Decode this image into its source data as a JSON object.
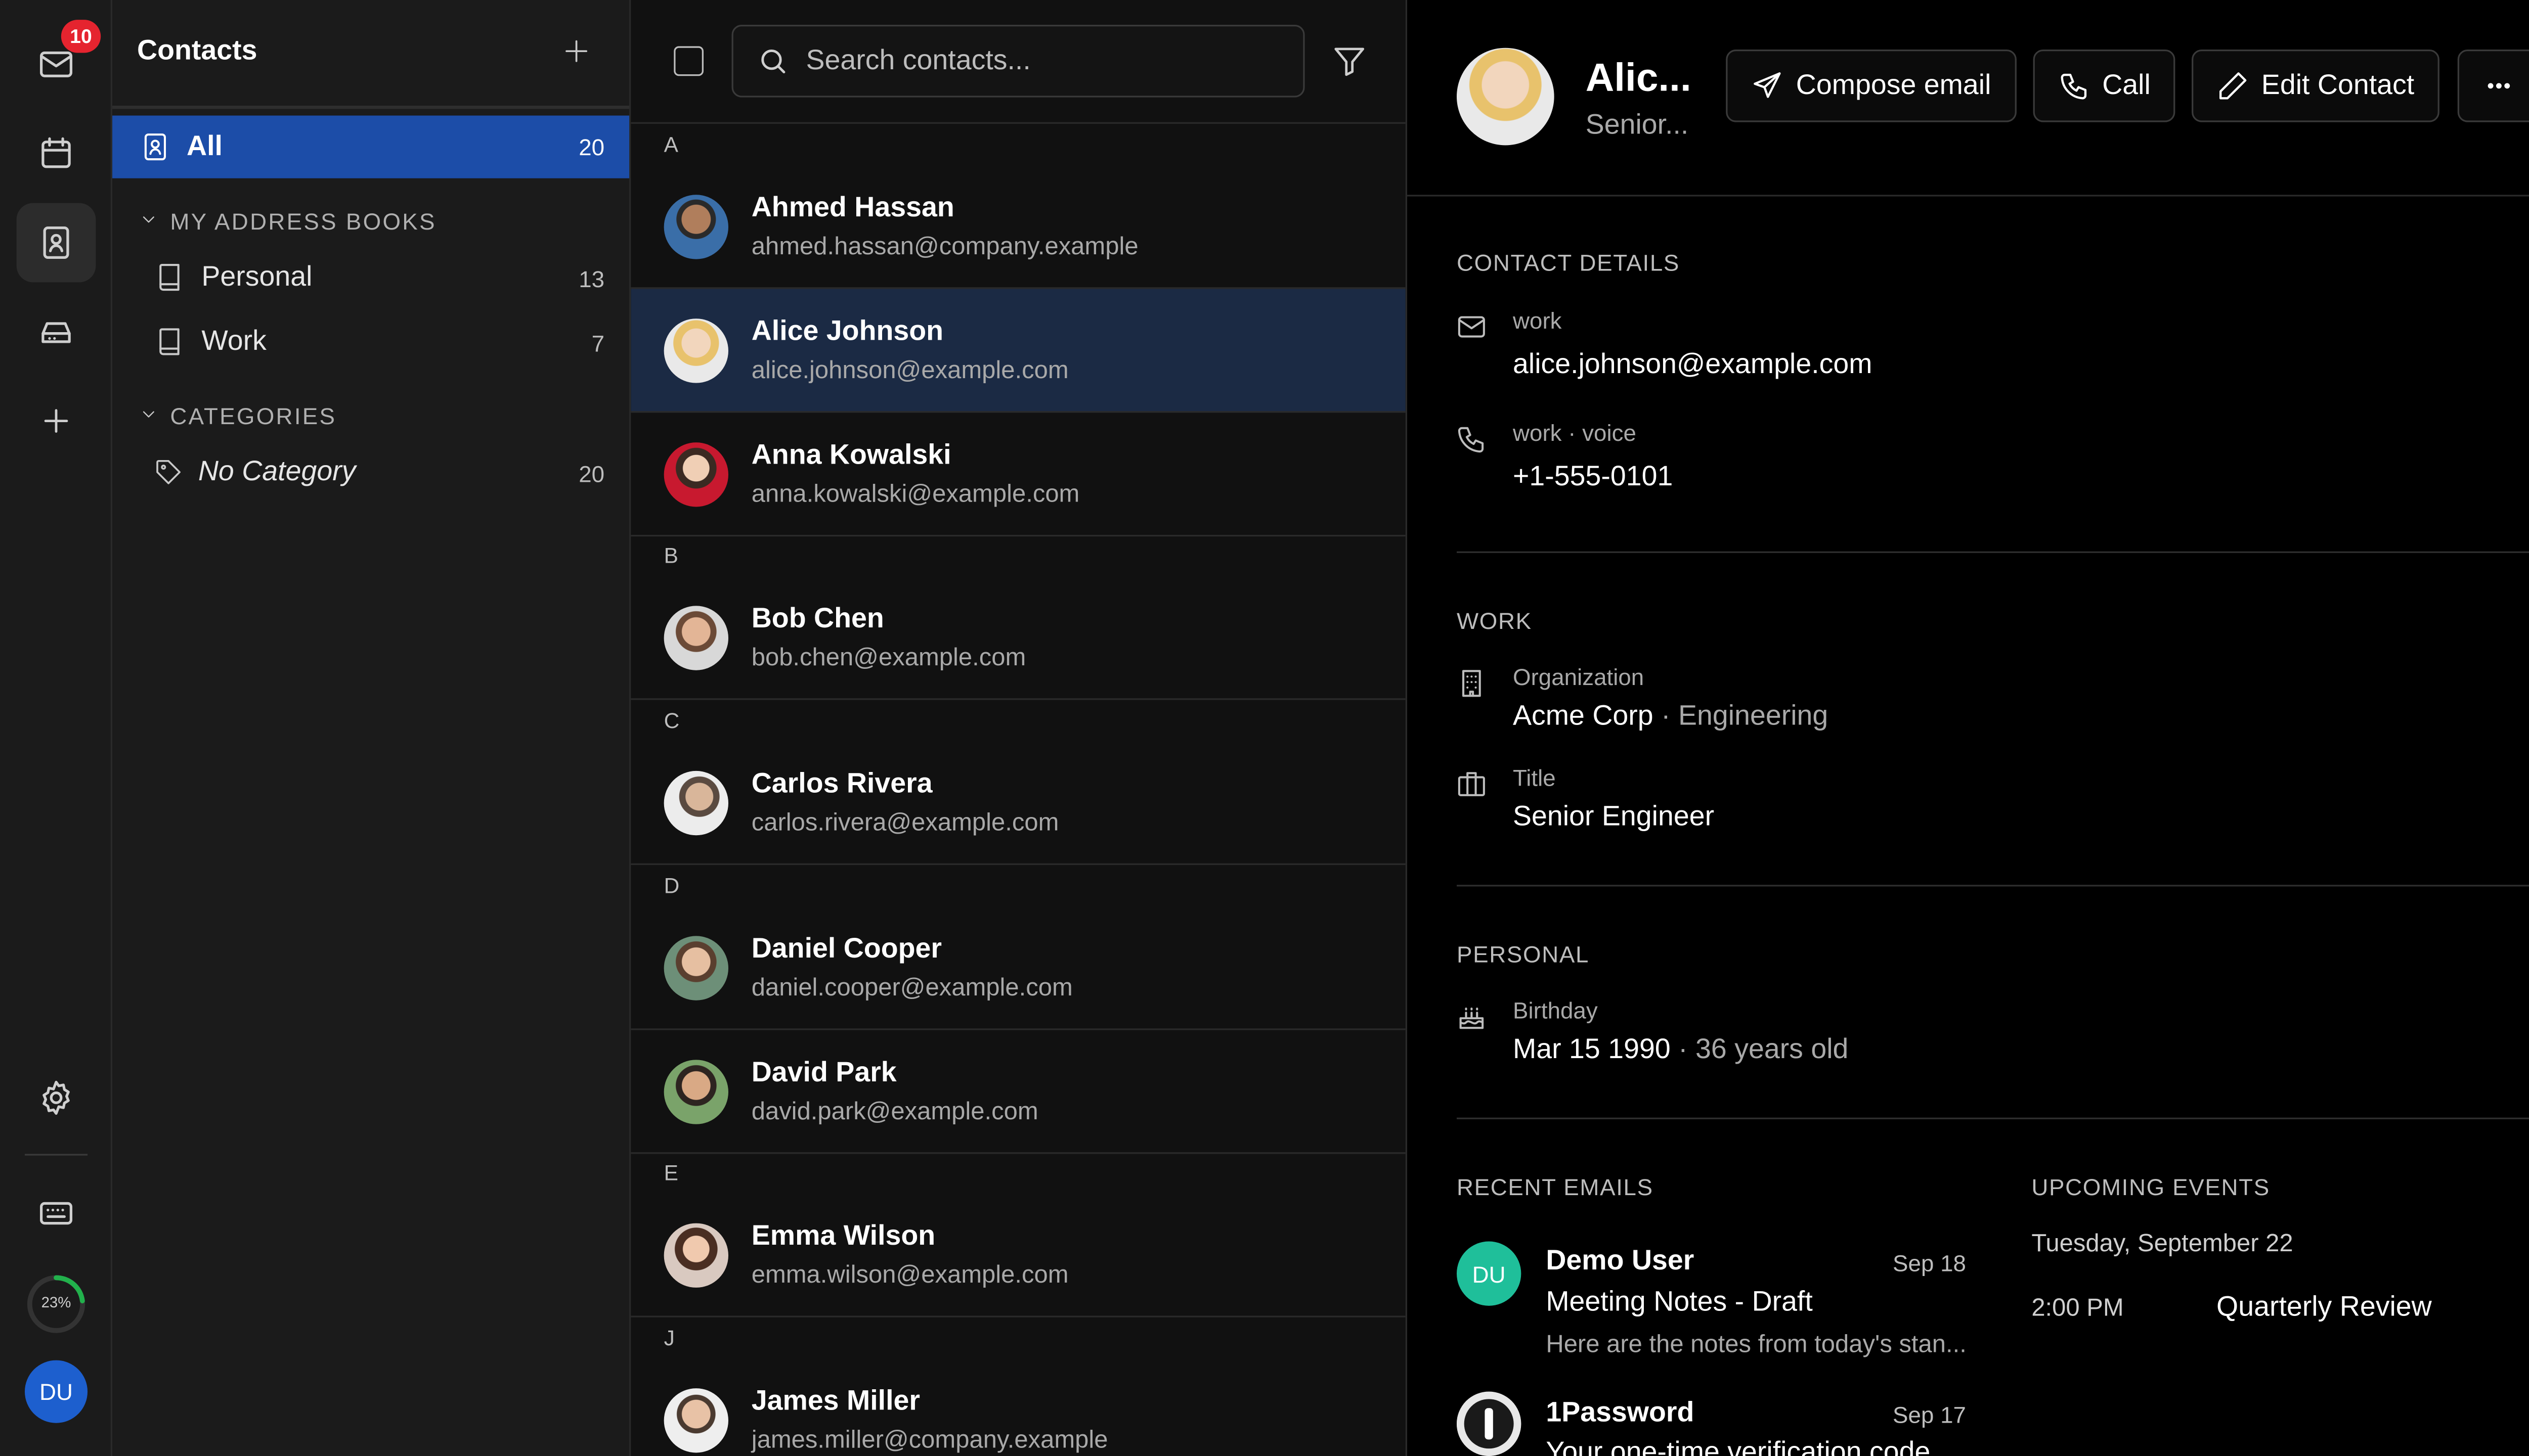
{
  "rail": {
    "mail_badge": "10",
    "progress_label": "23%",
    "progress_value": 0.23,
    "user_initials": "DU",
    "icons": [
      "mail-icon",
      "calendar-icon",
      "contacts-icon",
      "drive-icon",
      "plus-icon",
      "gear-icon",
      "keyboard-icon"
    ]
  },
  "sidebar": {
    "title": "Contacts",
    "all": {
      "label": "All",
      "count": "20"
    },
    "address_books_header": "MY ADDRESS BOOKS",
    "address_books": [
      {
        "label": "Personal",
        "count": "13"
      },
      {
        "label": "Work",
        "count": "7"
      }
    ],
    "categories_header": "CATEGORIES",
    "categories": [
      {
        "label": "No Category",
        "count": "20"
      }
    ]
  },
  "list": {
    "search_placeholder": "Search contacts...",
    "letters": {
      "a": "A",
      "b": "B",
      "c": "C",
      "d": "D",
      "e": "E",
      "j": "J"
    },
    "contacts": [
      {
        "name": "Ahmed Hassan",
        "email": "ahmed.hassan@company.example"
      },
      {
        "name": "Alice Johnson",
        "email": "alice.johnson@example.com"
      },
      {
        "name": "Anna Kowalski",
        "email": "anna.kowalski@example.com"
      },
      {
        "name": "Bob Chen",
        "email": "bob.chen@example.com"
      },
      {
        "name": "Carlos Rivera",
        "email": "carlos.rivera@example.com"
      },
      {
        "name": "Daniel Cooper",
        "email": "daniel.cooper@example.com"
      },
      {
        "name": "David Park",
        "email": "david.park@example.com"
      },
      {
        "name": "Emma Wilson",
        "email": "emma.wilson@example.com"
      },
      {
        "name": "James Miller",
        "email": "james.miller@company.example"
      }
    ]
  },
  "detail": {
    "name": "Alic...",
    "subtitle": "Senior...",
    "buttons": {
      "compose": "Compose email",
      "call": "Call",
      "edit": "Edit Contact"
    },
    "contact_details_header": "CONTACT DETAILS",
    "email_label": "work",
    "email_value": "alice.johnson@example.com",
    "phone_label": "work · voice",
    "phone_value": "+1-555-0101",
    "work_header": "WORK",
    "org_label": "Organization",
    "org_value": "Acme Corp",
    "org_dept": " · Engineering",
    "title_label": "Title",
    "title_value": "Senior Engineer",
    "personal_header": "PERSONAL",
    "birthday_label": "Birthday",
    "birthday_value": "Mar 15 1990",
    "birthday_age": " · 36 years old",
    "recent_emails_header": "RECENT EMAILS",
    "emails": [
      {
        "initials": "DU",
        "sender": "Demo User",
        "date": "Sep 18",
        "subject": "Meeting Notes - Draft",
        "preview": "Here are the notes from today's stan..."
      },
      {
        "initials": "",
        "sender": "1Password",
        "date": "Sep 17",
        "subject": "Your one-time verification code",
        "preview": ""
      }
    ],
    "upcoming_header": "UPCOMING EVENTS",
    "event_day": "Tuesday, September 22",
    "event_time": "2:00 PM",
    "event_title": "Quarterly Review"
  },
  "colors": {
    "accent": "#1c4da8",
    "selected_row": "#1b2a44",
    "badge": "#e5242f",
    "progress": "#22b14c",
    "du_avatar": "#1d5fce",
    "du_mail_avatar": "#1fbf9a"
  }
}
